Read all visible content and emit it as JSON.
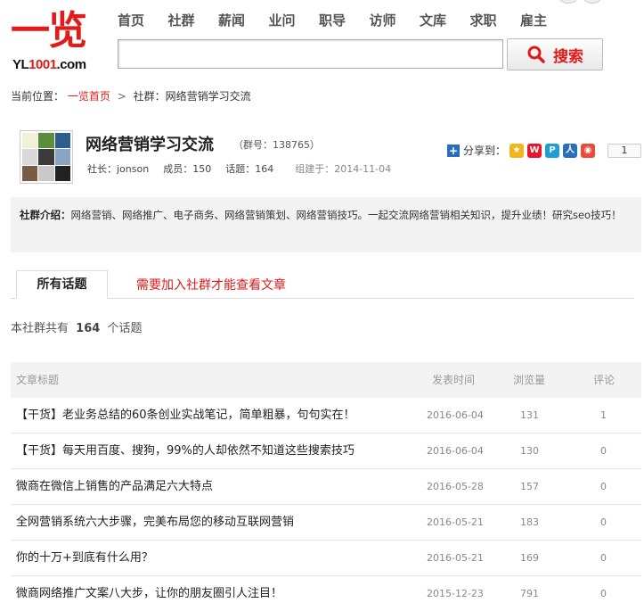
{
  "logo": {
    "cn": "一览",
    "en_prefix": "YL",
    "en_num": "1001",
    "en_suffix": ".com"
  },
  "nav": [
    "首页",
    "社群",
    "薪闻",
    "业问",
    "职导",
    "访师",
    "文库",
    "求职",
    "雇主"
  ],
  "search": {
    "value": "",
    "button": "搜索"
  },
  "breadcrumb": {
    "prefix": "当前位置：",
    "home": "一览首页",
    "sep": ">",
    "current": "社群：网络营销学习交流"
  },
  "group": {
    "name": "网络营销学习交流",
    "number": "（群号：138765）",
    "owner": "社长：jonson",
    "members": "成员：150",
    "topics": "话题：164",
    "founded": "组建于：2014-11-04"
  },
  "share": {
    "label": "分享到：",
    "count": "1"
  },
  "intro": {
    "label": "社群介绍：",
    "text": "网络营销、网络推广、电子商务、网络营销策划、网络营销技巧。一起交流网络营销相关知识，提升业绩！研究seo技巧！"
  },
  "tabs": {
    "active": "所有话题",
    "notice": "需要加入社群才能查看文章"
  },
  "summary": {
    "prefix": "本社群共有",
    "count": "164",
    "suffix": "个话题"
  },
  "table": {
    "headers": [
      "文章标题",
      "发表时间",
      "浏览量",
      "评论"
    ],
    "rows": [
      {
        "title": "【干货】老业务总结的60条创业实战笔记，简单粗暴，句句实在！",
        "date": "2016-06-04",
        "views": "131",
        "comments": "1"
      },
      {
        "title": "【干货】每天用百度、搜狗，99%的人却依然不知道这些搜索技巧",
        "date": "2016-06-04",
        "views": "130",
        "comments": "0"
      },
      {
        "title": "微商在微信上销售的产品满足六大特点",
        "date": "2016-05-28",
        "views": "157",
        "comments": "0"
      },
      {
        "title": "全网营销系统六大步骤，完美布局您的移动互联网营销",
        "date": "2016-05-21",
        "views": "183",
        "comments": "0"
      },
      {
        "title": "你的十万+到底有什么用？",
        "date": "2016-05-21",
        "views": "169",
        "comments": "0"
      },
      {
        "title": "微商网络推广文案八大步，让你的朋友圈引人注目！",
        "date": "2015-12-23",
        "views": "791",
        "comments": "0"
      }
    ]
  },
  "colors": {
    "brand_red": "#e21a1a",
    "panel_gray": "#f3f3f3"
  }
}
